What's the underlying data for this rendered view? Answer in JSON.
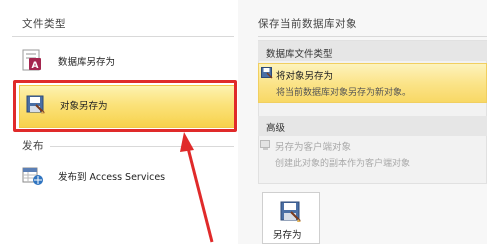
{
  "left": {
    "file_types_header": "文件类型",
    "items": [
      {
        "label": "数据库另存为",
        "icon": "access-database-icon"
      },
      {
        "label": "对象另存为",
        "icon": "save-object-icon",
        "selected": true
      }
    ],
    "publish_header": "发布",
    "publish_items": [
      {
        "label": "发布到 Access Services",
        "icon": "access-services-icon"
      }
    ]
  },
  "right": {
    "header": "保存当前数据库对象",
    "db_file_type_section": "数据库文件类型",
    "options": [
      {
        "title": "将对象另存为",
        "desc": "将当前数据库对象另存为新对象。",
        "selected": true,
        "icon": "save-object-icon"
      }
    ],
    "advanced_section": "高级",
    "advanced_options": [
      {
        "title": "另存为客户端对象",
        "desc": "创建此对象的副本作为客户端对象",
        "disabled": true,
        "icon": "client-object-icon"
      }
    ],
    "save_as_button": "另存为"
  },
  "colors": {
    "selection_yellow": "#fbe27a",
    "annotation_red": "#e02a2a",
    "rule_gray": "#d9d9d9"
  }
}
